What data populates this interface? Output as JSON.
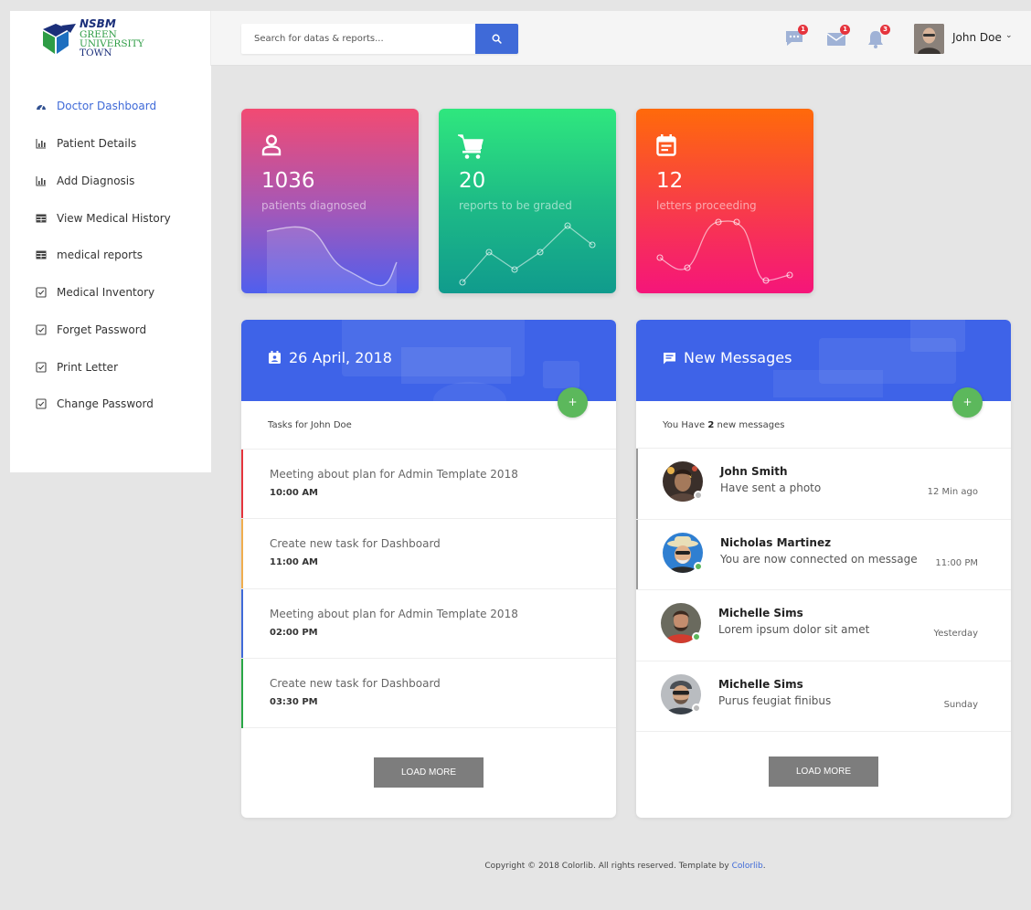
{
  "logo": {
    "brand": "NSBM",
    "line1": "GREEN",
    "line2": "UNIVERSITY",
    "line3": "TOWN"
  },
  "search": {
    "placeholder": "Search for datas & reports..."
  },
  "header": {
    "chat_count": "1",
    "mail_count": "1",
    "bell_count": "3",
    "user_name": "John Doe",
    "caret": "⌄"
  },
  "sidebar": {
    "items": [
      {
        "label": "Doctor Dashboard",
        "icon": "dashboard-icon",
        "active": true
      },
      {
        "label": "Patient Details",
        "icon": "bar-chart-icon"
      },
      {
        "label": "Add Diagnosis",
        "icon": "bar-chart-icon"
      },
      {
        "label": "View Medical History",
        "icon": "table-icon"
      },
      {
        "label": "medical reports",
        "icon": "table-icon"
      },
      {
        "label": "Medical Inventory",
        "icon": "checkbox-icon"
      },
      {
        "label": "Forget Password",
        "icon": "checkbox-icon"
      },
      {
        "label": "Print Letter",
        "icon": "checkbox-icon"
      },
      {
        "label": "Change Password",
        "icon": "checkbox-icon"
      }
    ]
  },
  "stats": [
    {
      "value": "1036",
      "label": "patients diagnosed",
      "icon": "user-icon",
      "colors": [
        "#f24a72",
        "#4f5fee"
      ]
    },
    {
      "value": "20",
      "label": "reports to be graded",
      "icon": "cart-icon",
      "colors": [
        "#2fe77e",
        "#109b8d"
      ]
    },
    {
      "value": "12",
      "label": "letters proceeding",
      "icon": "calendar-icon",
      "colors": [
        "#ff6a0a",
        "#f5157a"
      ]
    }
  ],
  "tasks_panel": {
    "title": "26 April, 2018",
    "fab": "+",
    "subtitle": "Tasks for John Doe",
    "tasks": [
      {
        "title": "Meeting about plan for Admin Template 2018",
        "time": "10:00 AM",
        "color": "#e5343d"
      },
      {
        "title": "Create new task for Dashboard",
        "time": "11:00 AM",
        "color": "#f0ad4e"
      },
      {
        "title": "Meeting about plan for Admin Template 2018",
        "time": "02:00 PM",
        "color": "#3f6ad8"
      },
      {
        "title": "Create new task for Dashboard",
        "time": "03:30 PM",
        "color": "#28a745"
      }
    ],
    "load_more": "LOAD MORE"
  },
  "messages_panel": {
    "title": "New Messages",
    "fab": "+",
    "subtitle_prefix": "You Have",
    "subtitle_count": "2",
    "subtitle_suffix": "new messages",
    "messages": [
      {
        "name": "John Smith",
        "text": "Have sent a photo",
        "time": "12 Min ago",
        "status": "#bbbbbb"
      },
      {
        "name": "Nicholas Martinez",
        "text": "You are now connected on message",
        "time": "11:00 PM",
        "status": "#5cb85c"
      },
      {
        "name": "Michelle Sims",
        "text": "Lorem ipsum dolor sit amet",
        "time": "Yesterday",
        "status": "#5cb85c"
      },
      {
        "name": "Michelle Sims",
        "text": "Purus feugiat finibus",
        "time": "Sunday",
        "status": "#bbbbbb"
      }
    ],
    "load_more": "LOAD MORE"
  },
  "footer": {
    "text": "Copyright © 2018 Colorlib. All rights reserved. Template by",
    "link": "Colorlib",
    "end": "."
  }
}
